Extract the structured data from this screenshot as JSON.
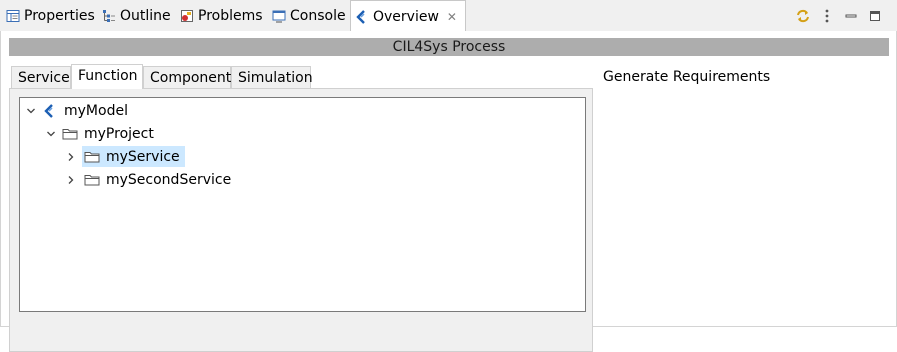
{
  "view_tabs": [
    {
      "label": "Properties",
      "icon": "properties-icon"
    },
    {
      "label": "Outline",
      "icon": "outline-icon"
    },
    {
      "label": "Problems",
      "icon": "problems-icon"
    },
    {
      "label": "Console",
      "icon": "console-icon"
    },
    {
      "label": "Overview",
      "icon": "overview-icon",
      "active": true
    }
  ],
  "view_toolbar": [
    "sync-icon",
    "view-menu-icon",
    "minimize-icon",
    "maximize-icon"
  ],
  "panel": {
    "title": "CIL4Sys Process",
    "tabs": [
      {
        "label": "Service"
      },
      {
        "label": "Function",
        "active": true
      },
      {
        "label": "Component"
      },
      {
        "label": "Simulation"
      }
    ],
    "tree": [
      {
        "label": "myModel",
        "expanded": true,
        "icon": "model-icon"
      },
      {
        "label": "myProject",
        "expanded": true,
        "icon": "folder-icon"
      },
      {
        "label": "myService",
        "expanded": false,
        "icon": "folder-icon",
        "selected": true
      },
      {
        "label": "mySecondService",
        "expanded": false,
        "icon": "folder-icon"
      }
    ],
    "side_label": "Generate Requirements"
  },
  "colors": {
    "title_bar": "#adadad",
    "selection": "#cce8ff",
    "accent_blue": "#1c5fb3"
  }
}
